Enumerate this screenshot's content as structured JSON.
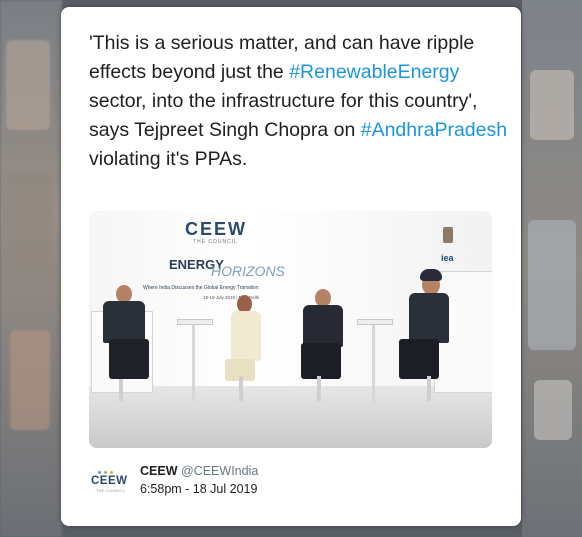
{
  "tweet": {
    "text_part1": "'This is a serious matter, and can have ripple effects beyond just the ",
    "hashtag1": "#RenewableEnergy",
    "text_part2": " sector, into the infrastructure for this country', says Tejpreet Singh Chopra on ",
    "hashtag2": "#AndhraPradesh",
    "text_part3": " violating it's PPAs."
  },
  "photo": {
    "logo": "CEEW",
    "logo_sub": "THE COUNCIL",
    "event_title_1": "ENERGY",
    "event_title_2": "HORIZONS",
    "tagline": "Where India Discusses the Global Energy Transition",
    "date": "18-19 July 2019 | New Delhi",
    "partner": "iea"
  },
  "author": {
    "name": "CEEW",
    "handle": "@CEEWIndia",
    "logo_text": "CEEW",
    "logo_sub": "THE COUNCIL"
  },
  "timestamp": "6:58pm - 18 Jul 2019",
  "colors": {
    "hashtag": "#1b95e0",
    "text": "#1c2022",
    "muted": "#697882",
    "card": "#ffffff"
  }
}
